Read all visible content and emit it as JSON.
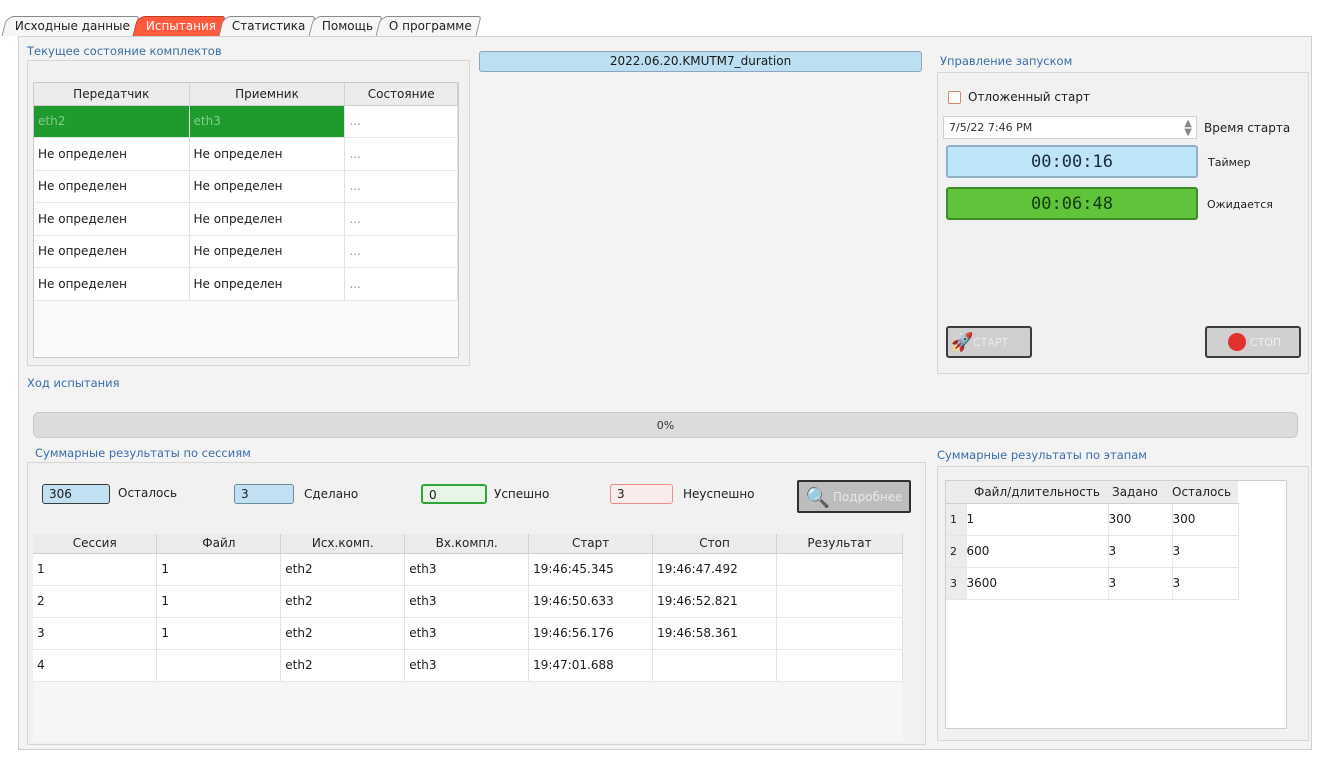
{
  "tabs": [
    "Исходные данные",
    "Испытания",
    "Статистика",
    "Помощь",
    "О программе"
  ],
  "sections": {
    "komplekt": "Текущее состояние комплектов",
    "control": "Управление запуском",
    "progress": "Ход испытания",
    "sessions": "Суммарные результаты по сессиям",
    "stages": "Суммарные результаты по этапам"
  },
  "komplekt_table": {
    "headers": [
      "Передатчик",
      "Приемник",
      "Состояние"
    ],
    "rows": [
      [
        "eth2",
        "eth3",
        "..."
      ],
      [
        "Не определен",
        "Не определен",
        "..."
      ],
      [
        "Не определен",
        "Не определен",
        "..."
      ],
      [
        "Не определен",
        "Не определен",
        "..."
      ],
      [
        "Не определен",
        "Не определен",
        "..."
      ],
      [
        "Не определен",
        "Не определен",
        "..."
      ]
    ]
  },
  "filename": "2022.06.20.KMUTM7_duration",
  "control": {
    "delayed_start_label": "Отложенный старт",
    "start_time_value": "7/5/22 7:46 PM",
    "start_time_label": "Время старта",
    "timer_value": "00:00:16",
    "timer_label": "Таймер",
    "expected_value": "00:06:48",
    "expected_label": "Ожидается",
    "start_button": "СТАРТ",
    "stop_button": "СТОП"
  },
  "progress": {
    "text": "0%",
    "value": 0
  },
  "counters": {
    "remaining_value": "306",
    "remaining_label": "Осталось",
    "done_value": "3",
    "done_label": "Сделано",
    "success_value": "0",
    "success_label": "Успешно",
    "fail_value": "3",
    "fail_label": "Неуспешно",
    "more_button": "Подробнее"
  },
  "sessions_table": {
    "headers": [
      "Сессия",
      "Файл",
      "Исх.комп.",
      "Вх.компл.",
      "Старт",
      "Стоп",
      "Результат"
    ],
    "rows": [
      [
        "1",
        "1",
        "eth2",
        "eth3",
        "19:46:45.345",
        "19:46:47.492",
        ""
      ],
      [
        "2",
        "1",
        "eth2",
        "eth3",
        "19:46:50.633",
        "19:46:52.821",
        ""
      ],
      [
        "3",
        "1",
        "eth2",
        "eth3",
        "19:46:56.176",
        "19:46:58.361",
        ""
      ],
      [
        "4",
        "",
        "eth2",
        "eth3",
        "19:47:01.688",
        "",
        ""
      ]
    ]
  },
  "stages_table": {
    "headers": [
      "Файл/длительность",
      "Задано",
      "Осталось"
    ],
    "rows": [
      [
        "1",
        "1",
        "300",
        "300"
      ],
      [
        "2",
        "600",
        "3",
        "3"
      ],
      [
        "3",
        "3600",
        "3",
        "3"
      ]
    ]
  },
  "colors": {
    "active_tab": "#ff5a3c",
    "ok_green": "#1f9a2d",
    "timer_blue": "#bde4f7",
    "timer_green": "#5fc43a"
  }
}
